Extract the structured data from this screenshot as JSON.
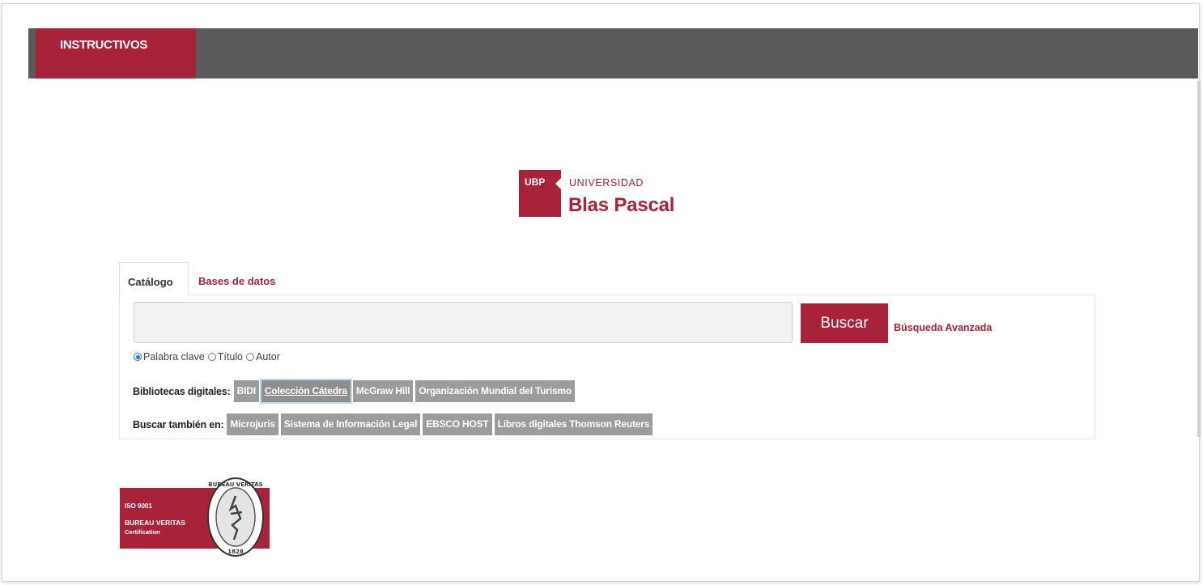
{
  "nav": {
    "instructivos_label": "INSTRUCTIVOS"
  },
  "logo": {
    "ubp": "UBP",
    "line1": "UNIVERSIDAD",
    "line2": "Blas Pascal"
  },
  "search": {
    "tabs": [
      {
        "label": "Catálogo",
        "active": true
      },
      {
        "label": "Bases de datos",
        "active": false
      }
    ],
    "input_value": "",
    "button_label": "Buscar",
    "advanced_link": "Búsqueda Avanzada",
    "radio_options": [
      {
        "label": "Palabra clave",
        "checked": true
      },
      {
        "label": "Título",
        "checked": false
      },
      {
        "label": "Autor",
        "checked": false
      }
    ]
  },
  "digital_libraries": {
    "label": "Bibliotecas digitales:",
    "items": [
      "BIDI",
      "Colección Cátedra",
      "McGraw Hill",
      "Organización Mundial del Turismo"
    ],
    "selected": "Colección Cátedra"
  },
  "search_also": {
    "label": "Buscar también en:",
    "items": [
      "Microjuris",
      "Sistema de Información Legal",
      "EBSCO HOST",
      "Libros digitales Thomson Reuters"
    ]
  },
  "certification": {
    "line1": "ISO 9001",
    "line2": "BUREAU VERITAS",
    "line3": "Certification",
    "seal_text": "BUREAU VERITAS",
    "seal_year": "1828"
  },
  "colors": {
    "brand": "#a8223a",
    "nav_bar": "#5a5a5a",
    "chip": "#9c9c9c",
    "radio_selected": "#1a73e8"
  }
}
